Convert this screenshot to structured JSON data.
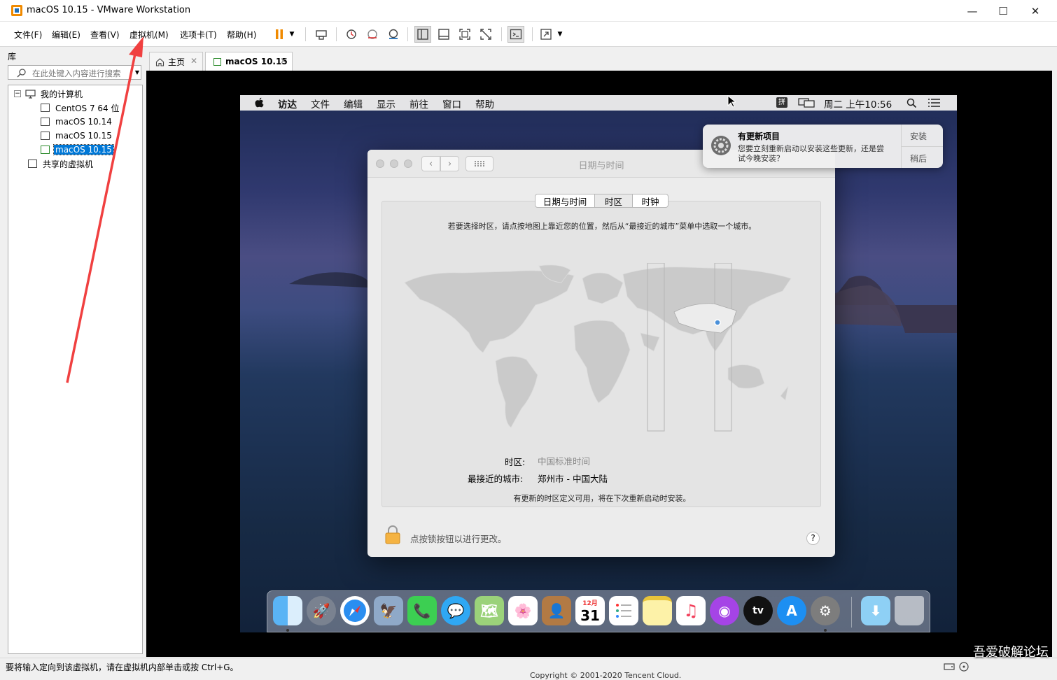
{
  "window": {
    "title": "macOS 10.15 - VMware Workstation",
    "controls": {
      "minimize": "—",
      "maximize": "☐",
      "close": "✕"
    }
  },
  "menu": [
    {
      "label": "文件(F)"
    },
    {
      "label": "编辑(E)"
    },
    {
      "label": "查看(V)"
    },
    {
      "label": "虚拟机(M)"
    },
    {
      "label": "选项卡(T)"
    },
    {
      "label": "帮助(H)"
    }
  ],
  "toolbar": {
    "icons": [
      "pause-icon",
      "send-ctrl-alt-del-icon",
      "snapshot-icon",
      "revert-snapshot-icon",
      "snapshot-manager-icon",
      "library-view-icon",
      "thumbnail-view-icon",
      "fullscreen-icon",
      "unity-icon",
      "console-icon",
      "stretch-icon"
    ],
    "accent": "#f08a00"
  },
  "library": {
    "title": "库",
    "search_placeholder": "在此处键入内容进行搜索",
    "tree": {
      "root": "我的计算机",
      "vms": [
        {
          "label": "CentOS 7 64 位",
          "selected": false
        },
        {
          "label": "macOS 10.14",
          "selected": false
        },
        {
          "label": "macOS 10.15",
          "selected": false
        },
        {
          "label": "macOS 10.15",
          "selected": true
        }
      ],
      "shared": "共享的虚拟机"
    }
  },
  "tabs": [
    {
      "label": "主页",
      "close": "✕",
      "active": false
    },
    {
      "label": "macOS 10.15",
      "close": "✕",
      "active": true
    }
  ],
  "guest": {
    "menubar": {
      "apple": "",
      "items": [
        "访达",
        "文件",
        "编辑",
        "显示",
        "前往",
        "窗口",
        "帮助"
      ],
      "input_method": "拼",
      "clock": "周二 上午10:56"
    },
    "notification": {
      "title": "有更新项目",
      "body_line1": "您要立刻重新启动以安装这些更新，还是尝",
      "body_line2": "试今晚安装？",
      "install": "安装",
      "later": "稍后"
    },
    "pref": {
      "title": "日期与时间",
      "tabs": [
        "日期与时间",
        "时区",
        "时钟"
      ],
      "active_tab": "时区",
      "instruction": "若要选择时区，请点按地图上靠近您的位置，然后从“最接近的城市”菜单中选取一个城市。",
      "timezone_label": "时区:",
      "timezone_value": "中国标准时间",
      "city_label": "最接近的城市:",
      "city_value": "郑州市 - 中国大陆",
      "note": "有更新的时区定义可用，将在下次重新启动时安装。",
      "lock_text": "点按锁按钮以进行更改。",
      "help": "?"
    },
    "dock": {
      "calendar_month": "12月",
      "calendar_day": "31",
      "tv_label": "tv"
    }
  },
  "status": {
    "message": "要将输入定向到该虚拟机，请在虚拟机内部单击或按 Ctrl+G。",
    "copyright": "Copyright © 2001-2020  Tencent Cloud."
  },
  "watermark": "吾爱破解论坛"
}
